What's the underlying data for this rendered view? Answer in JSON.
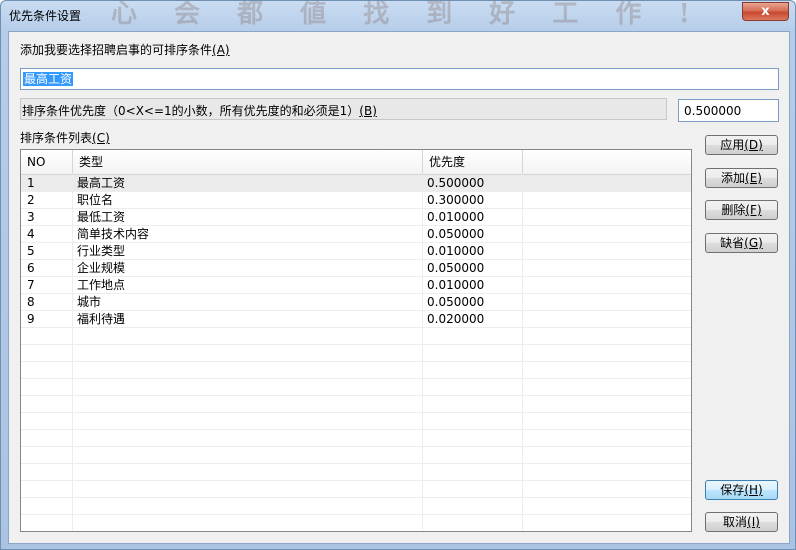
{
  "window": {
    "title": "优先条件设置",
    "close_label": "x",
    "banner_text": "心 会 都 値 找 到 好 工 作 !"
  },
  "condition_label": {
    "text": "添加我要选择招聘启事的可排序条件",
    "hotkey": "(A)"
  },
  "condition_input": {
    "value": "最高工资"
  },
  "priority_label": {
    "text": "排序条件优先度（0<X<=1的小数，所有优先度的和必须是1）",
    "hotkey": "(B)"
  },
  "priority_input": {
    "value": "0.500000"
  },
  "list_label": {
    "text": "排序条件列表",
    "hotkey": "(C)"
  },
  "table": {
    "headers": [
      "NO",
      "类型",
      "优先度"
    ],
    "rows": [
      {
        "no": "1",
        "type": "最高工资",
        "priority": "0.500000"
      },
      {
        "no": "2",
        "type": "职位名",
        "priority": "0.300000"
      },
      {
        "no": "3",
        "type": "最低工资",
        "priority": "0.010000"
      },
      {
        "no": "4",
        "type": "简单技术内容",
        "priority": "0.050000"
      },
      {
        "no": "5",
        "type": "行业类型",
        "priority": "0.010000"
      },
      {
        "no": "6",
        "type": "企业规模",
        "priority": "0.050000"
      },
      {
        "no": "7",
        "type": "工作地点",
        "priority": "0.010000"
      },
      {
        "no": "8",
        "type": "城市",
        "priority": "0.050000"
      },
      {
        "no": "9",
        "type": "福利待遇",
        "priority": "0.020000"
      }
    ]
  },
  "buttons": {
    "apply": {
      "text": "应用",
      "hotkey": "(D)"
    },
    "add": {
      "text": "添加",
      "hotkey": "(E)"
    },
    "delete": {
      "text": "删除",
      "hotkey": "(F)"
    },
    "default": {
      "text": "缺省",
      "hotkey": "(G)"
    },
    "save": {
      "text": "保存",
      "hotkey": "(H)"
    },
    "cancel": {
      "text": "取消",
      "hotkey": "(I)"
    }
  }
}
